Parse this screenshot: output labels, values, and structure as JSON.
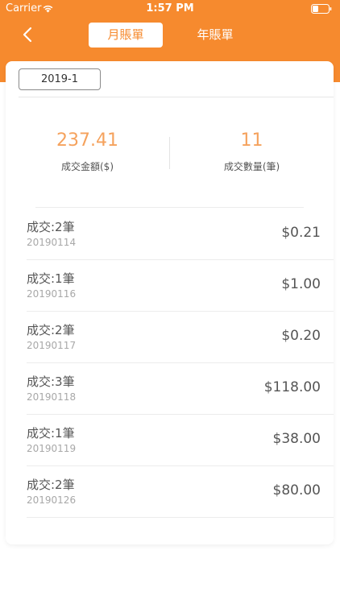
{
  "status_bar": {
    "carrier": "Carrier",
    "time": "1:57 PM"
  },
  "nav": {
    "back_icon": "chevron-left-icon",
    "tabs": [
      {
        "label": "月賬單",
        "active": true
      },
      {
        "label": "年賬單",
        "active": false
      }
    ]
  },
  "filter": {
    "month": "2019-1"
  },
  "summary": {
    "amount_value": "237.41",
    "amount_label": "成交金額($)",
    "count_value": "11",
    "count_label": "成交數量(筆)"
  },
  "records": [
    {
      "title": "成交:2筆",
      "date": "20190114",
      "amount": "$0.21"
    },
    {
      "title": "成交:1筆",
      "date": "20190116",
      "amount": "$1.00"
    },
    {
      "title": "成交:2筆",
      "date": "20190117",
      "amount": "$0.20"
    },
    {
      "title": "成交:3筆",
      "date": "20190118",
      "amount": "$118.00"
    },
    {
      "title": "成交:1筆",
      "date": "20190119",
      "amount": "$38.00"
    },
    {
      "title": "成交:2筆",
      "date": "20190126",
      "amount": "$80.00"
    }
  ],
  "colors": {
    "accent": "#f68a2e",
    "summary_value": "#f5a25d"
  }
}
